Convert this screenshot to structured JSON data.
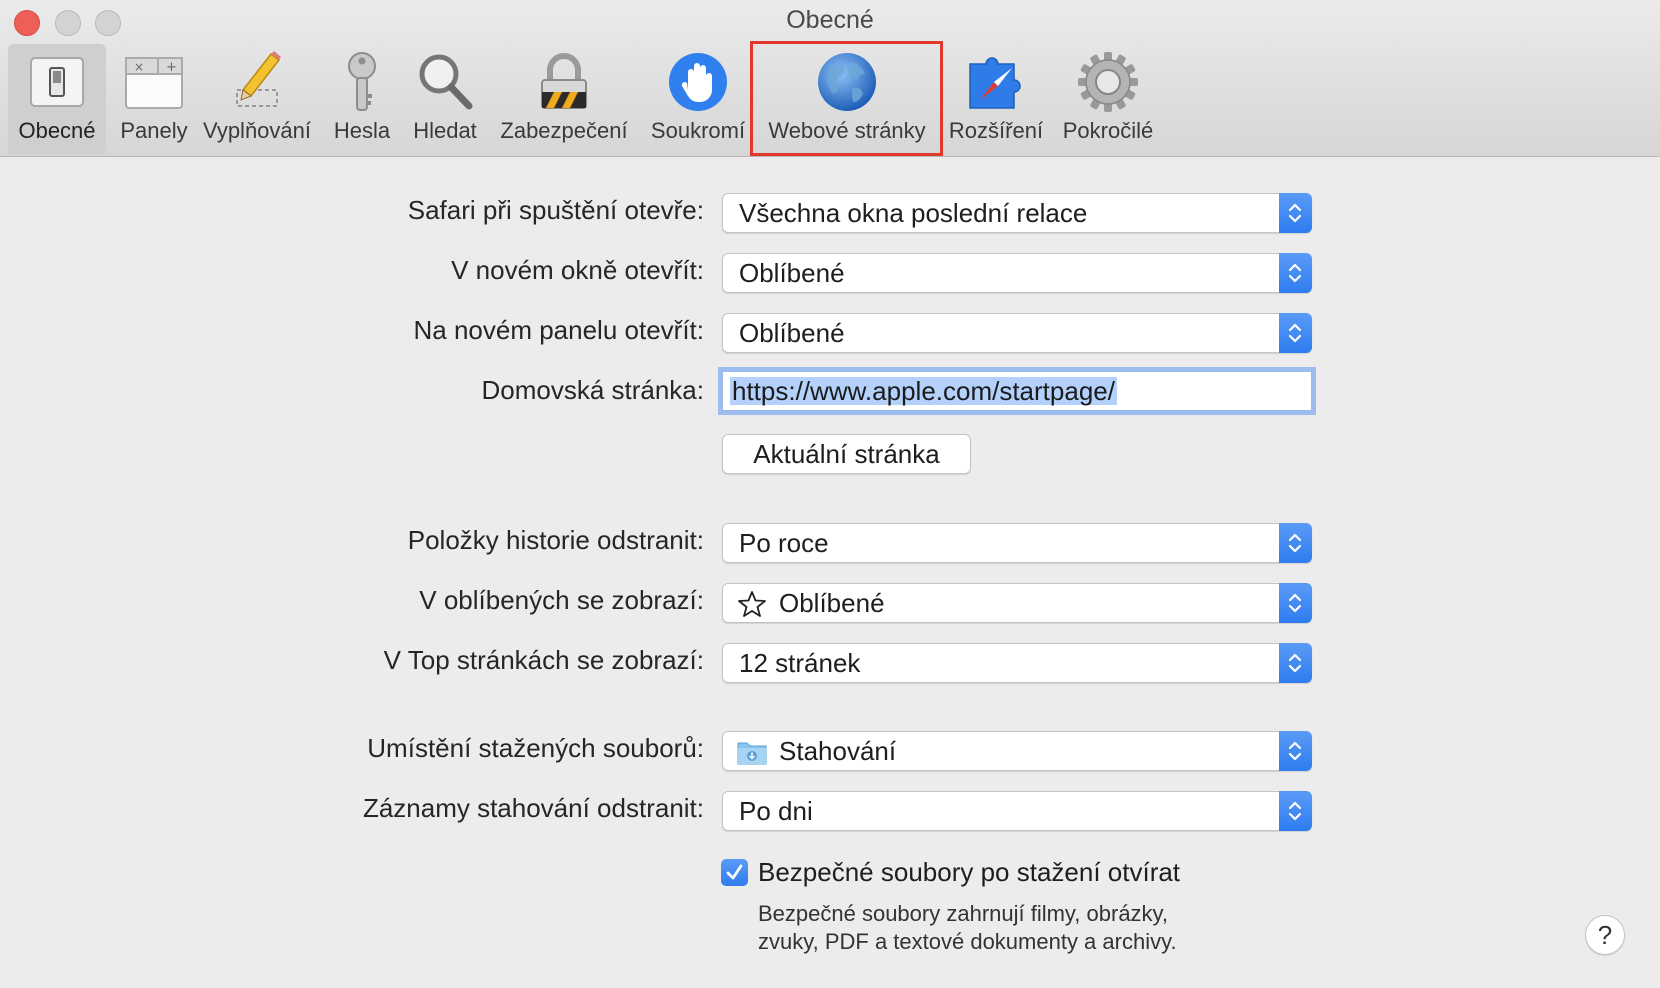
{
  "window": {
    "title": "Obecné"
  },
  "toolbar": {
    "items": [
      {
        "label": "Obecné",
        "icon": "general-switch-icon",
        "selected": true
      },
      {
        "label": "Panely",
        "icon": "tabs-icon"
      },
      {
        "label": "Vyplňování",
        "icon": "pencil-icon"
      },
      {
        "label": "Hesla",
        "icon": "key-icon"
      },
      {
        "label": "Hledat",
        "icon": "magnifier-icon"
      },
      {
        "label": "Zabezpečení",
        "icon": "padlock-icon"
      },
      {
        "label": "Soukromí",
        "icon": "hand-icon"
      },
      {
        "label": "Webové stránky",
        "icon": "globe-icon",
        "highlighted": true
      },
      {
        "label": "Rozšíření",
        "icon": "puzzle-compass-icon"
      },
      {
        "label": "Pokročilé",
        "icon": "gear-icon"
      }
    ],
    "highlight_color": "#e0392c"
  },
  "settings": {
    "safari_opens_with": {
      "label": "Safari při spuštění otevře:",
      "value": "Všechna okna poslední relace"
    },
    "new_windows_open_with": {
      "label": "V novém okně otevřít:",
      "value": "Oblíbené"
    },
    "new_tabs_open_with": {
      "label": "Na novém panelu otevřít:",
      "value": "Oblíbené"
    },
    "homepage": {
      "label": "Domovská stránka:",
      "value": "https://www.apple.com/startpage/",
      "button_label": "Aktuální stránka"
    },
    "remove_history": {
      "label": "Položky historie odstranit:",
      "value": "Po roce"
    },
    "favorites_shows": {
      "label": "V oblíbených se zobrazí:",
      "value": "Oblíbené",
      "icon": "star-icon"
    },
    "top_sites_shows": {
      "label": "V Top stránkách se zobrazí:",
      "value": "12 stránek"
    },
    "download_location": {
      "label": "Umístění stažených souborů:",
      "value": "Stahování",
      "icon": "downloads-folder-icon"
    },
    "remove_downloads": {
      "label": "Záznamy stahování odstranit:",
      "value": "Po dni"
    },
    "open_safe_files": {
      "label": "Bezpečné soubory po stažení otvírat",
      "checked": true,
      "help_line1": "Bezpečné soubory zahrnují filmy, obrázky,",
      "help_line2": "zvuky, PDF a textové dokumenty a archivy."
    }
  },
  "help_button": {
    "label": "?"
  },
  "colors": {
    "accent": "#2f7cf0",
    "close": "#ee5f57"
  }
}
